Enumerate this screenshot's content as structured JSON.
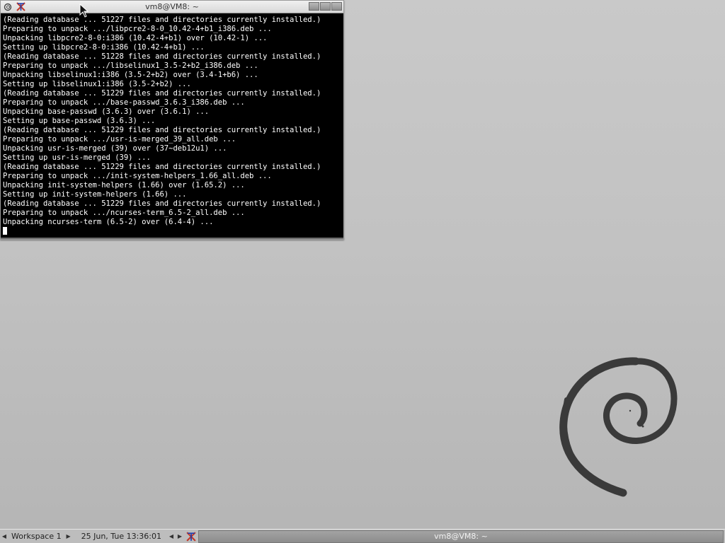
{
  "terminal": {
    "title": "vm8@VM8: ~",
    "lines": [
      "(Reading database ... 51227 files and directories currently installed.)",
      "Preparing to unpack .../libpcre2-8-0_10.42-4+b1_i386.deb ...",
      "Unpacking libpcre2-8-0:i386 (10.42-4+b1) over (10.42-1) ...",
      "Setting up libpcre2-8-0:i386 (10.42-4+b1) ...",
      "(Reading database ... 51228 files and directories currently installed.)",
      "Preparing to unpack .../libselinux1_3.5-2+b2_i386.deb ...",
      "Unpacking libselinux1:i386 (3.5-2+b2) over (3.4-1+b6) ...",
      "Setting up libselinux1:i386 (3.5-2+b2) ...",
      "(Reading database ... 51229 files and directories currently installed.)",
      "Preparing to unpack .../base-passwd_3.6.3_i386.deb ...",
      "Unpacking base-passwd (3.6.3) over (3.6.1) ...",
      "Setting up base-passwd (3.6.3) ...",
      "(Reading database ... 51229 files and directories currently installed.)",
      "Preparing to unpack .../usr-is-merged_39_all.deb ...",
      "Unpacking usr-is-merged (39) over (37~deb12u1) ...",
      "Setting up usr-is-merged (39) ...",
      "(Reading database ... 51229 files and directories currently installed.)",
      "Preparing to unpack .../init-system-helpers_1.66_all.deb ...",
      "Unpacking init-system-helpers (1.66) over (1.65.2) ...",
      "Setting up init-system-helpers (1.66) ...",
      "(Reading database ... 51229 files and directories currently installed.)",
      "Preparing to unpack .../ncurses-term_6.5-2_all.deb ...",
      "Unpacking ncurses-term (6.5-2) over (6.4-4) ..."
    ]
  },
  "taskbar": {
    "workspace_label": "Workspace 1",
    "clock": "25 Jun, Tue 13:36:01",
    "task_label": "vm8@VM8: ~"
  },
  "icons": {
    "window_menu": "debian-swirl-icon",
    "app": "xterm-icon",
    "desktop_logo": "debian-logo"
  },
  "colors": {
    "terminal_bg": "#000000",
    "terminal_fg": "#ffffff",
    "desktop_bg": "#c4c4c4",
    "logo": "#3a3a3a"
  }
}
